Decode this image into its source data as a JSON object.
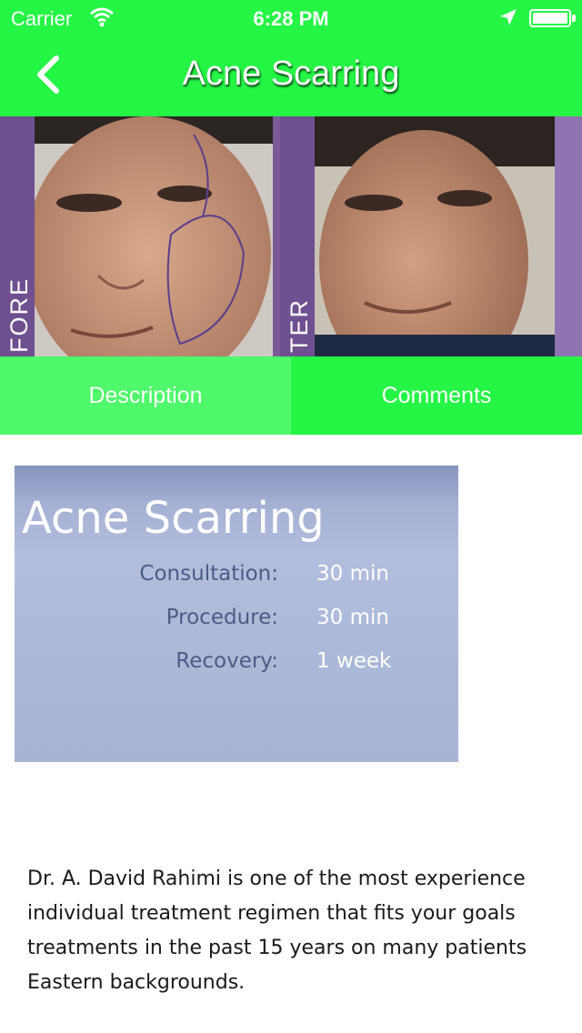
{
  "status_bar": {
    "carrier": "Carrier",
    "time": "6:28 PM"
  },
  "nav": {
    "title": "Acne Scarring",
    "back_icon": "chevron-left-icon"
  },
  "hero": {
    "before_label": "FORE",
    "after_label": "TER"
  },
  "tabs": [
    {
      "label": "Description",
      "selected": true
    },
    {
      "label": "Comments",
      "selected": false
    }
  ],
  "card": {
    "title": "Acne Scarring",
    "rows": [
      {
        "label": "Consultation:",
        "value": "30 min"
      },
      {
        "label": "Procedure:",
        "value": "30 min"
      },
      {
        "label": "Recovery:",
        "value": "1 week"
      }
    ]
  },
  "body": {
    "lines": [
      "Dr. A. David Rahimi is one of the most experience",
      "individual treatment regimen that fits your goals",
      "treatments in the past 15 years on many patients",
      "Eastern backgrounds."
    ]
  },
  "colors": {
    "accent_green": "#25f545",
    "tab_selected": "#4ef86a",
    "card_blue": "#aebad9"
  }
}
